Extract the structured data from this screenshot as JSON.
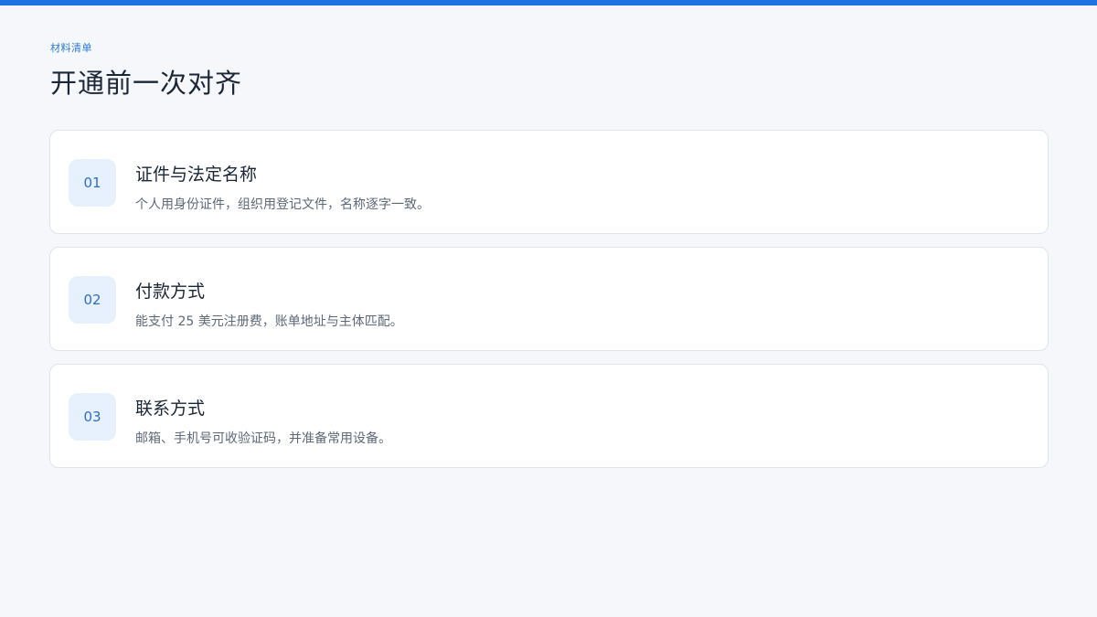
{
  "header": {
    "eyebrow": "材料清单",
    "title": "开通前一次对齐"
  },
  "colors": {
    "accent": "#1f73e0",
    "background": "#f5f7fb",
    "badge_bg": "#e7f0fd"
  },
  "items": [
    {
      "number": "01",
      "title": "证件与法定名称",
      "description": "个人用身份证件，组织用登记文件，名称逐字一致。"
    },
    {
      "number": "02",
      "title": "付款方式",
      "description": "能支付 25 美元注册费，账单地址与主体匹配。"
    },
    {
      "number": "03",
      "title": "联系方式",
      "description": "邮箱、手机号可收验证码，并准备常用设备。"
    }
  ]
}
